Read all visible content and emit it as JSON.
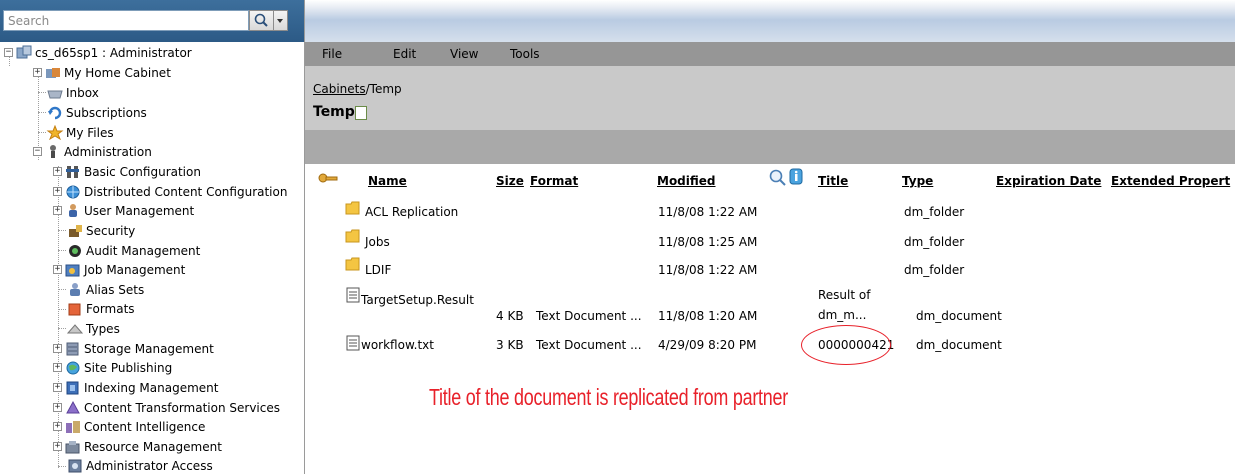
{
  "search": {
    "placeholder": "Search"
  },
  "tree": {
    "root": {
      "label": "cs_d65sp1 : Administrator"
    },
    "items": [
      {
        "label": "My Home Cabinet",
        "icon": "home-cabinet-icon"
      },
      {
        "label": "Inbox",
        "icon": "inbox-icon"
      },
      {
        "label": "Subscriptions",
        "icon": "subscriptions-icon"
      },
      {
        "label": "My Files",
        "icon": "my-files-icon"
      },
      {
        "label": "Administration",
        "icon": "administration-icon"
      },
      {
        "label": "Basic Configuration",
        "icon": "basic-configuration-icon"
      },
      {
        "label": "Distributed Content Configuration",
        "icon": "distributed-content-icon"
      },
      {
        "label": "User Management",
        "icon": "user-management-icon"
      },
      {
        "label": "Security",
        "icon": "security-icon"
      },
      {
        "label": "Audit Management",
        "icon": "audit-icon"
      },
      {
        "label": "Job Management",
        "icon": "job-icon"
      },
      {
        "label": "Alias Sets",
        "icon": "alias-icon"
      },
      {
        "label": "Formats",
        "icon": "formats-icon"
      },
      {
        "label": "Types",
        "icon": "types-icon"
      },
      {
        "label": "Storage Management",
        "icon": "storage-icon"
      },
      {
        "label": "Site Publishing",
        "icon": "site-publishing-icon"
      },
      {
        "label": "Indexing Management",
        "icon": "indexing-icon"
      },
      {
        "label": "Content Transformation Services",
        "icon": "transformation-icon"
      },
      {
        "label": "Content Intelligence",
        "icon": "intelligence-icon"
      },
      {
        "label": "Resource Management",
        "icon": "resource-icon"
      },
      {
        "label": "Administrator Access",
        "icon": "admin-access-icon"
      }
    ]
  },
  "menu": {
    "file": "File",
    "edit": "Edit",
    "view": "View",
    "tools": "Tools"
  },
  "location": {
    "breadcrumb_link": "Cabinets",
    "breadcrumb_rest": "/Temp",
    "folder_title": "Temp"
  },
  "columns": {
    "name": "Name",
    "size": "Size",
    "format": "Format",
    "modified": "Modified",
    "title": "Title",
    "type": "Type",
    "expiration": "Expiration Date",
    "extended": "Extended Propert"
  },
  "rows": [
    {
      "name": "ACL Replication",
      "size": "",
      "format": "",
      "modified": "11/8/08 1:22 AM",
      "title": "",
      "type": "dm_folder"
    },
    {
      "name": "Jobs",
      "size": "",
      "format": "",
      "modified": "11/8/08 1:25 AM",
      "title": "",
      "type": "dm_folder"
    },
    {
      "name": "LDIF",
      "size": "",
      "format": "",
      "modified": "11/8/08 1:22 AM",
      "title": "",
      "type": "dm_folder"
    },
    {
      "name": "TargetSetup.Result",
      "size": "4 KB",
      "format": "Text Document ...",
      "modified": "11/8/08 1:20 AM",
      "title_line1": "Result of",
      "title_line2": "dm_m...",
      "type": "dm_document"
    },
    {
      "name": "workflow.txt",
      "size": "3 KB",
      "format": "Text Document ...",
      "modified": "4/29/09 8:20 PM",
      "title": "0000000421",
      "type": "dm_document"
    }
  ],
  "annotation": {
    "text": "Title of the document is replicated from partner",
    "color": "#e8212a"
  },
  "colors": {
    "menubar": "#969696",
    "path_area": "#c9c9c9",
    "gray_bar": "#a9a9a9",
    "search_bar": "#2c5a86"
  }
}
